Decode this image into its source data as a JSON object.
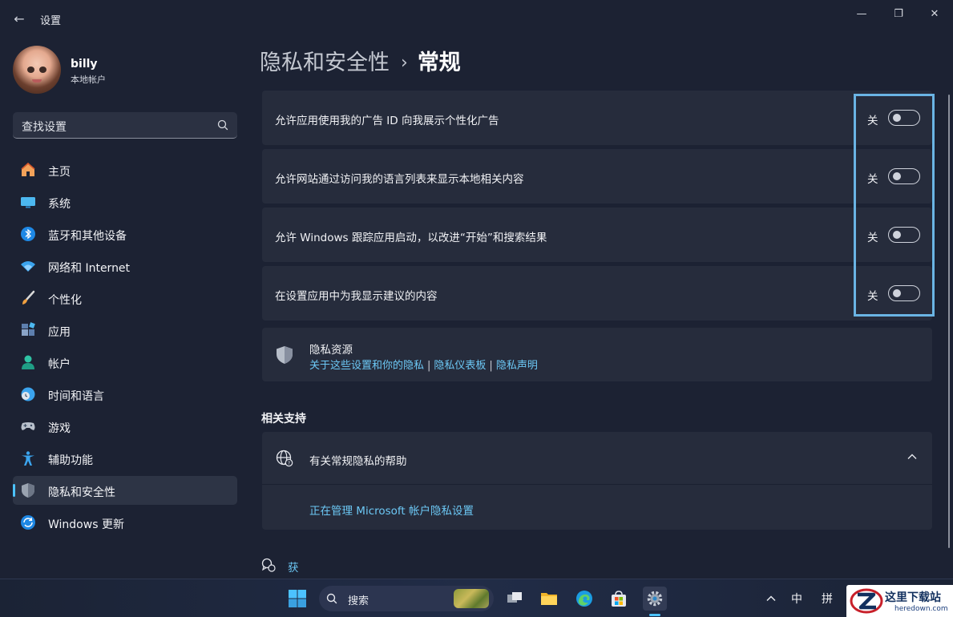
{
  "window": {
    "title": "设置",
    "back_glyph": "←",
    "minimize_glyph": "—",
    "maximize_glyph": "❐",
    "close_glyph": "✕"
  },
  "user": {
    "name": "billy",
    "account_type": "本地帐户"
  },
  "search": {
    "placeholder": "查找设置"
  },
  "nav": {
    "items": [
      {
        "label": "主页",
        "icon": "home-icon"
      },
      {
        "label": "系统",
        "icon": "monitor-icon"
      },
      {
        "label": "蓝牙和其他设备",
        "icon": "bluetooth-icon"
      },
      {
        "label": "网络和 Internet",
        "icon": "wifi-icon"
      },
      {
        "label": "个性化",
        "icon": "brush-icon"
      },
      {
        "label": "应用",
        "icon": "apps-icon"
      },
      {
        "label": "帐户",
        "icon": "account-icon"
      },
      {
        "label": "时间和语言",
        "icon": "clock-globe-icon"
      },
      {
        "label": "游戏",
        "icon": "gamepad-icon"
      },
      {
        "label": "辅助功能",
        "icon": "accessibility-icon"
      },
      {
        "label": "隐私和安全性",
        "icon": "shield-icon",
        "active": true
      },
      {
        "label": "Windows 更新",
        "icon": "update-icon"
      }
    ]
  },
  "breadcrumb": {
    "parent": "隐私和安全性",
    "separator": "›",
    "current": "常规"
  },
  "settings": [
    {
      "label": "允许应用使用我的广告 ID 向我展示个性化广告",
      "state": "关",
      "on": false
    },
    {
      "label": "允许网站通过访问我的语言列表来显示本地相关内容",
      "state": "关",
      "on": false
    },
    {
      "label": "允许 Windows 跟踪应用启动，以改进“开始”和搜索结果",
      "state": "关",
      "on": false
    },
    {
      "label": "在设置应用中为我显示建议的内容",
      "state": "关",
      "on": false
    }
  ],
  "privacy_resources": {
    "title": "隐私资源",
    "links": [
      "关于这些设置和你的隐私",
      "隐私仪表板",
      "隐私声明"
    ],
    "separator": "|"
  },
  "related_support": {
    "section_title": "相关支持",
    "help_title": "有关常规隐私的帮助",
    "link": "正在管理 Microsoft 帐户隐私设置"
  },
  "get_help": "获取帮助",
  "taskbar": {
    "search_label": "搜索",
    "ime_1": "中",
    "ime_2": "拼"
  },
  "watermark": {
    "name": "这里下载站",
    "url": "heredown.com"
  },
  "colors": {
    "background": "#1c2233",
    "card": "#262c3c",
    "accent": "#4cc2ff",
    "link": "#6cc8f5",
    "highlight": "#6ab4e4"
  }
}
